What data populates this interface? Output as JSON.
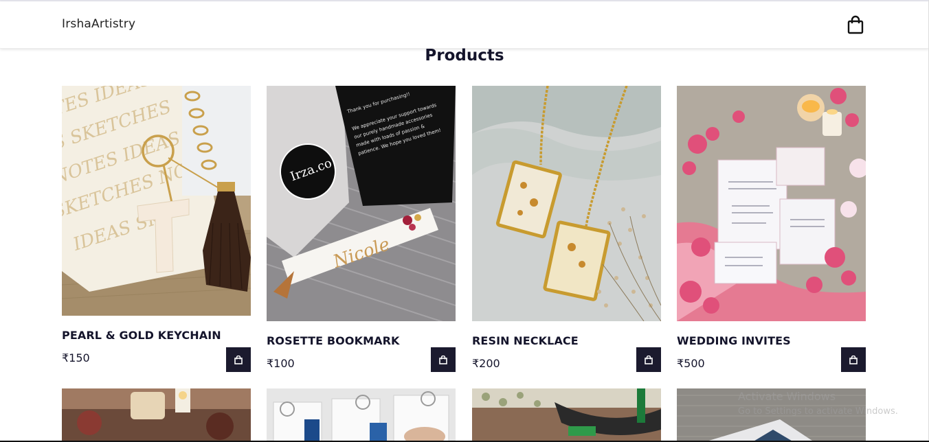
{
  "header": {
    "brand": "IrshaArtistry",
    "cart_icon": "shopping-bag-icon"
  },
  "page": {
    "title": "Products"
  },
  "products": [
    {
      "name": "PEARL & GOLD KEYCHAIN",
      "price": "₹150",
      "image": "pearl-gold-keychain-photo"
    },
    {
      "name": "ROSETTE BOOKMARK",
      "price": "₹100",
      "image": "rosette-bookmark-photo"
    },
    {
      "name": "RESIN NECKLACE",
      "price": "₹200",
      "image": "resin-necklace-photo"
    },
    {
      "name": "WEDDING INVITES",
      "price": "₹500",
      "image": "wedding-invites-photo"
    }
  ],
  "second_row": [
    {
      "image": "candle-resin-photo"
    },
    {
      "image": "blue-keychains-photo"
    },
    {
      "image": "embroidery-photo"
    },
    {
      "image": "grey-fabric-photo"
    }
  ],
  "os_overlay": {
    "line1": "Activate Windows",
    "line2": "Go to Settings to activate Windows."
  },
  "colors": {
    "button": "#1b1a2e",
    "text": "#14142b"
  }
}
